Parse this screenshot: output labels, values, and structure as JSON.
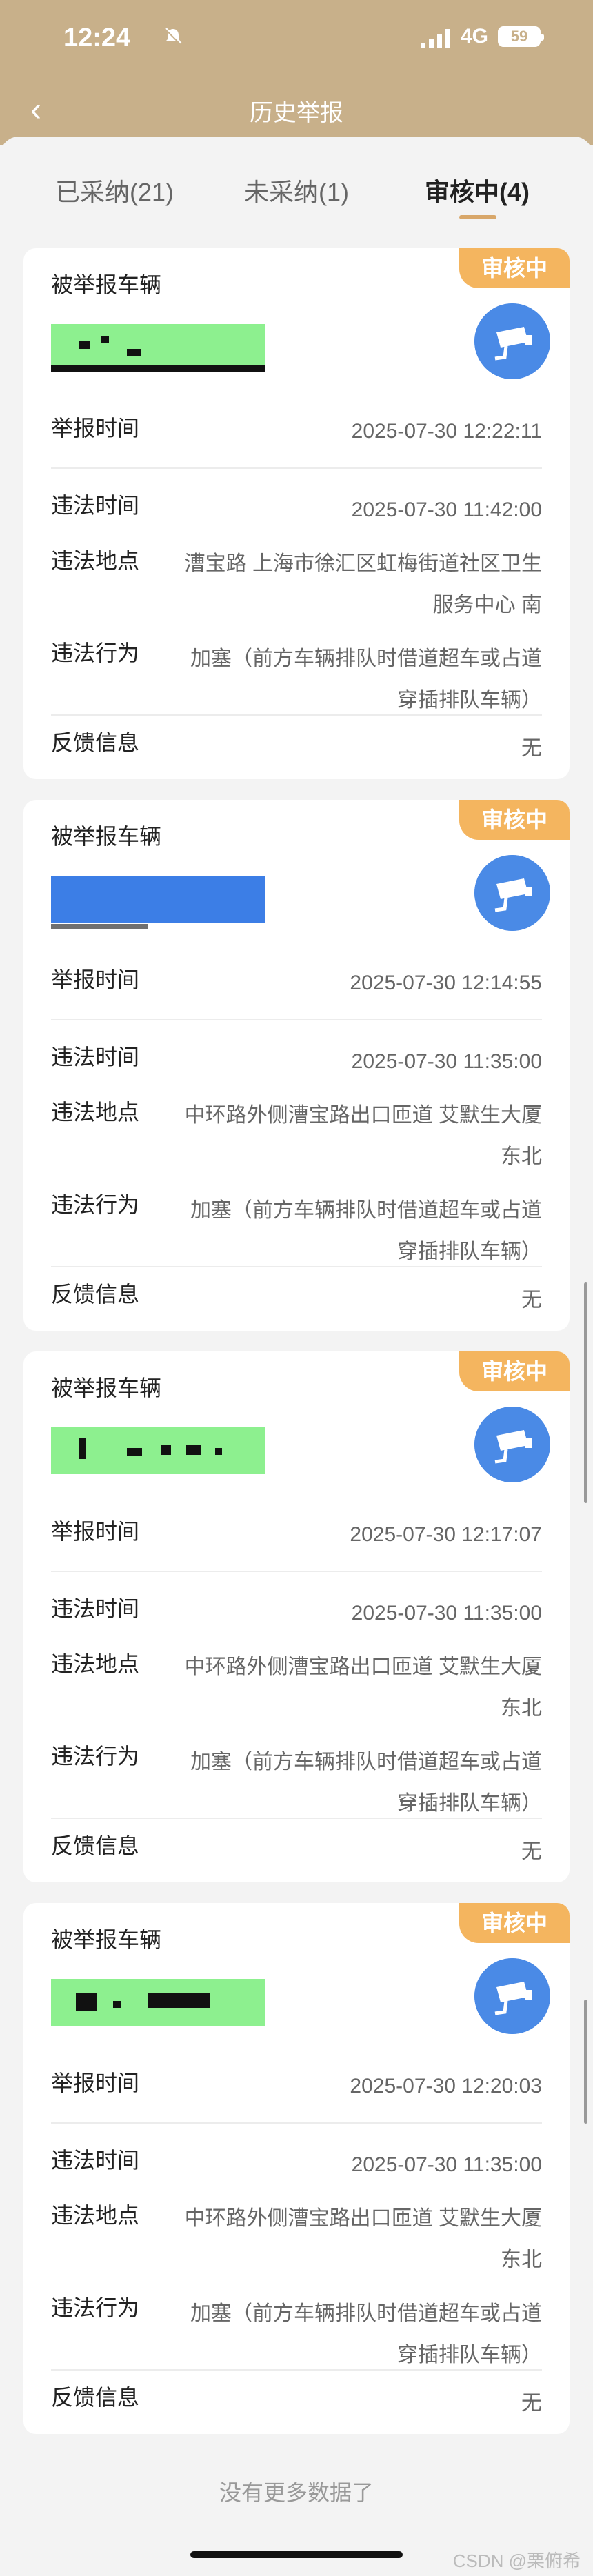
{
  "status": {
    "time": "12:24",
    "network": "4G",
    "battery": "59"
  },
  "nav": {
    "back": "‹",
    "title": "历史举报"
  },
  "tabs": [
    {
      "label": "已采纳(21)",
      "active": false
    },
    {
      "label": "未采纳(1)",
      "active": false
    },
    {
      "label": "审核中(4)",
      "active": true
    }
  ],
  "accent_color": "#d8a76a",
  "badge_color": "#f4b55f",
  "camera_color": "#4a8ae6",
  "labels": {
    "plate": "被举报车辆",
    "report_time": "举报时间",
    "violation_time": "违法时间",
    "location": "违法地点",
    "behavior": "违法行为",
    "feedback": "反馈信息"
  },
  "cards": [
    {
      "badge": "审核中",
      "report_time": "2025-07-30 12:22:11",
      "violation_time": "2025-07-30 11:42:00",
      "location": "漕宝路 上海市徐汇区虹梅街道社区卫生服务中心 南",
      "behavior": "加塞（前方车辆排队时借道超车或占道穿插排队车辆）",
      "feedback": "无"
    },
    {
      "badge": "审核中",
      "report_time": "2025-07-30 12:14:55",
      "violation_time": "2025-07-30 11:35:00",
      "location": "中环路外侧漕宝路出口匝道 艾默生大厦 东北",
      "behavior": "加塞（前方车辆排队时借道超车或占道穿插排队车辆）",
      "feedback": "无"
    },
    {
      "badge": "审核中",
      "report_time": "2025-07-30 12:17:07",
      "violation_time": "2025-07-30 11:35:00",
      "location": "中环路外侧漕宝路出口匝道 艾默生大厦 东北",
      "behavior": "加塞（前方车辆排队时借道超车或占道穿插排队车辆）",
      "feedback": "无"
    },
    {
      "badge": "审核中",
      "report_time": "2025-07-30 12:20:03",
      "violation_time": "2025-07-30 11:35:00",
      "location": "中环路外侧漕宝路出口匝道 艾默生大厦 东北",
      "behavior": "加塞（前方车辆排队时借道超车或占道穿插排队车辆）",
      "feedback": "无"
    }
  ],
  "footer": "没有更多数据了",
  "watermark": "CSDN @栗俯希"
}
